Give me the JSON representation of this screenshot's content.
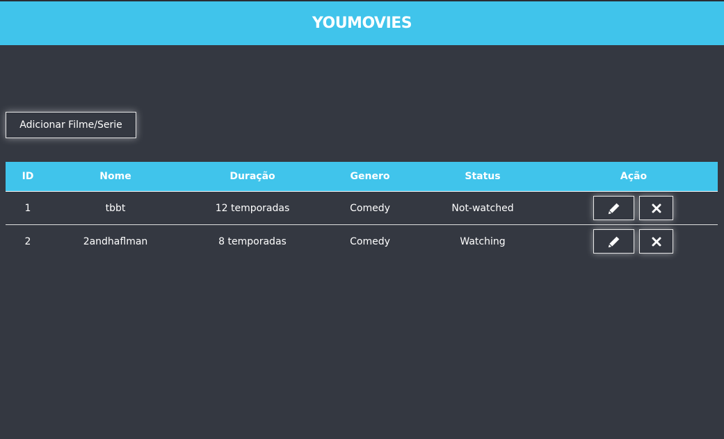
{
  "header": {
    "brand": "YOUMOVIES"
  },
  "toolbar": {
    "add_label": "Adicionar Filme/Serie"
  },
  "table": {
    "columns": [
      "ID",
      "Nome",
      "Duração",
      "Genero",
      "Status",
      "Ação"
    ],
    "rows": [
      {
        "id": "1",
        "nome": "tbbt",
        "duracao": "12 temporadas",
        "genero": "Comedy",
        "status": "Not-watched"
      },
      {
        "id": "2",
        "nome": "2andhaflman",
        "duracao": "8 temporadas",
        "genero": "Comedy",
        "status": "Watching"
      }
    ]
  },
  "icons": {
    "edit": "pencil-icon",
    "delete": "close-icon"
  },
  "colors": {
    "accent": "#40c4eb",
    "background": "#343841",
    "text": "#ffffff"
  }
}
